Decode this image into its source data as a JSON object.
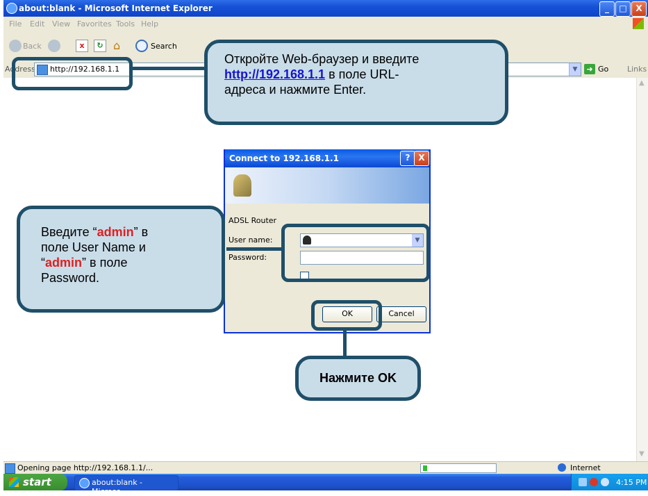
{
  "window": {
    "title": "about:blank - Microsoft Internet Explorer",
    "buttons": {
      "min": "_",
      "max": "□",
      "close": "X"
    }
  },
  "menu": [
    "File",
    "Edit",
    "View",
    "Favorites",
    "Tools",
    "Help"
  ],
  "toolbar": {
    "back_label": "Back",
    "search_label": "Search"
  },
  "address_bar": {
    "label": "Address",
    "url": "http://192.168.1.1",
    "go_label": "Go",
    "links_label": "Links"
  },
  "dialog": {
    "title": "Connect to 192.168.1.1",
    "realm": "ADSL Router",
    "user_label": "User name:",
    "password_label": "Password:",
    "ok_label": "OK",
    "cancel_label": "Cancel"
  },
  "callouts": {
    "browser": {
      "line1": "Откройте Web-браузер и введите",
      "url": "http://192.168.1.1",
      "line2_suffix": " в поле URL-",
      "line3": "адреса и нажмите Enter."
    },
    "credentials": {
      "l1_pre": "Введите “",
      "admin": "admin",
      "l1_post": "” в",
      "l2": "поле User Name и",
      "l3_pre": "“",
      "l3_post": "” в поле",
      "l4": "Password."
    },
    "ok": {
      "text": "Нажмите OK"
    }
  },
  "status_bar": {
    "text": "Opening page http://192.168.1.1/...",
    "zone": "Internet"
  },
  "taskbar": {
    "start_label": "start",
    "task_label": "about:blank - Microso...",
    "clock": "4:15 PM"
  },
  "colors": {
    "callout_border": "#1f4f69",
    "callout_fill": "#c9dde9",
    "accent_red": "#e02020",
    "link_blue": "#1515d0"
  }
}
